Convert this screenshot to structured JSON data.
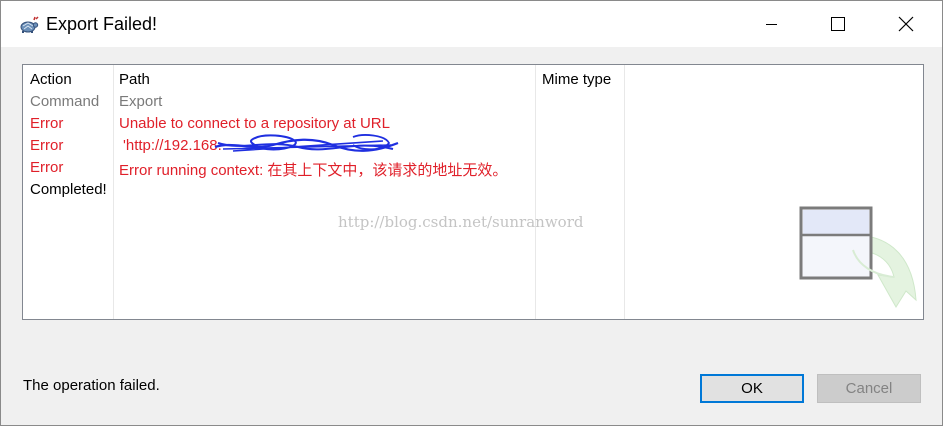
{
  "window": {
    "title": "Export Failed!",
    "icon": "tortoise-svn-icon"
  },
  "listview": {
    "columns": [
      "Action",
      "Path",
      "Mime type"
    ],
    "rows": [
      {
        "action": "Command",
        "path": "Export",
        "mime": "",
        "style": "gray"
      },
      {
        "action": "Error",
        "path": "Unable to connect to a repository at URL",
        "mime": "",
        "style": "red"
      },
      {
        "action": "Error",
        "path": "'http://192.168.",
        "mime": "",
        "style": "red"
      },
      {
        "action": "Error",
        "path": "Error running context: 在其上下文中，该请求的地址无效。",
        "mime": "",
        "style": "red"
      },
      {
        "action": "Completed!",
        "path": "",
        "mime": "",
        "style": "black"
      }
    ],
    "watermark": "http://blog.csdn.net/sunranword"
  },
  "footer": {
    "status": "The operation failed.",
    "ok_label": "OK",
    "cancel_label": "Cancel"
  },
  "colors": {
    "error": "#e0202a",
    "muted": "#7a7a7a",
    "accent": "#0078d7"
  }
}
